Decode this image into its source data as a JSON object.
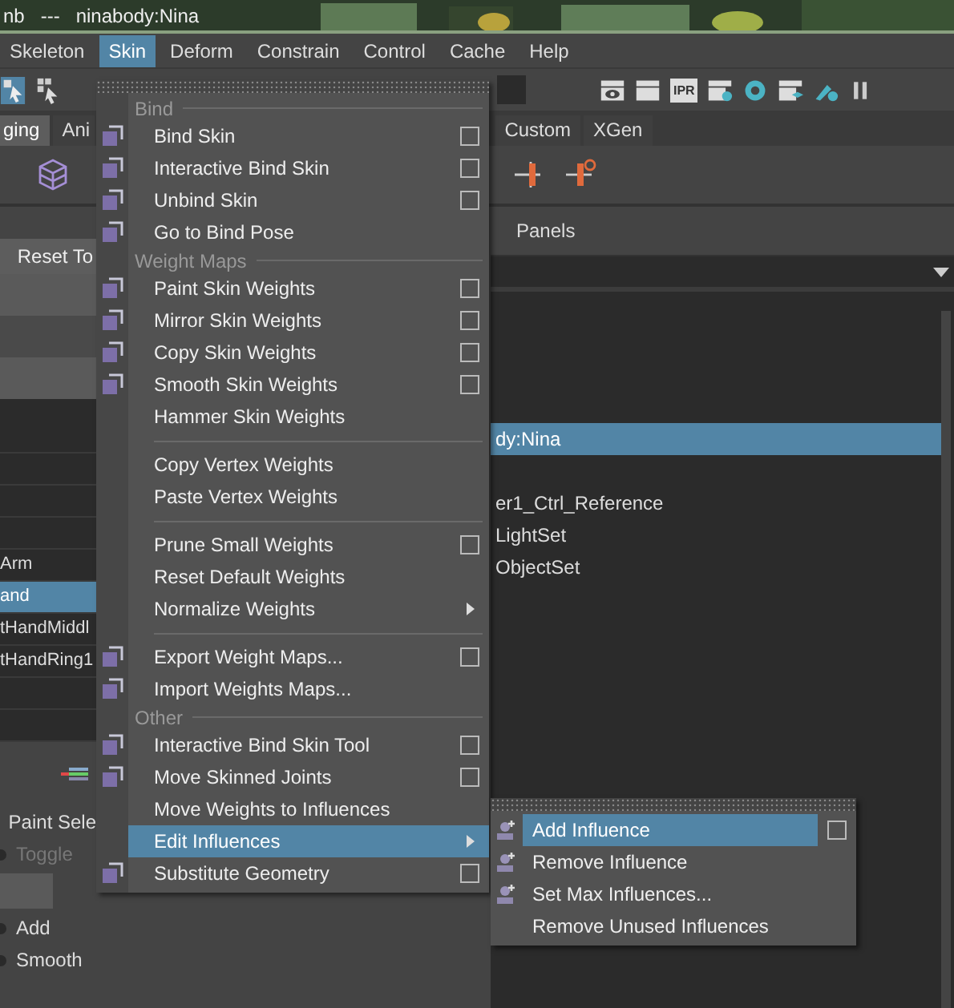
{
  "title_bar": {
    "text": "nb   ---   ninabody:Nina"
  },
  "menu_bar": [
    {
      "label": "Skeleton",
      "selected": false
    },
    {
      "label": "Skin",
      "selected": true
    },
    {
      "label": "Deform",
      "selected": false
    },
    {
      "label": "Constrain",
      "selected": false
    },
    {
      "label": "Control",
      "selected": false
    },
    {
      "label": "Cache",
      "selected": false
    },
    {
      "label": "Help",
      "selected": false
    }
  ],
  "toolbar": {
    "render_label": "IPR"
  },
  "shelf_tabs": [
    {
      "label": "ging",
      "selected": true
    },
    {
      "label": "Ani",
      "selected": false
    },
    {
      "label": "Custom",
      "selected": false
    },
    {
      "label": "XGen",
      "selected": false
    }
  ],
  "left_panel": {
    "reset_button": "Reset To",
    "rows": [
      {
        "label": "Arm",
        "selected": false
      },
      {
        "label": "and",
        "selected": true
      },
      {
        "label": "tHandMiddl",
        "selected": false
      },
      {
        "label": "tHandRing1",
        "selected": false
      }
    ],
    "options": [
      {
        "label": "Paint Sele",
        "disabled": false
      },
      {
        "label": "Toggle",
        "disabled": true
      },
      {
        "kind": "field"
      },
      {
        "label": "Add",
        "disabled": false
      },
      {
        "label": "Smooth",
        "disabled": false
      }
    ]
  },
  "outliner": {
    "header": "Panels",
    "rows": [
      {
        "label": "dy:Nina",
        "selected": true
      },
      {
        "label": "er1_Ctrl_Reference",
        "selected": false
      },
      {
        "label": "LightSet",
        "selected": false
      },
      {
        "label": "ObjectSet",
        "selected": false
      }
    ]
  },
  "skin_menu": [
    {
      "kind": "header",
      "label": "Bind"
    },
    {
      "kind": "item",
      "label": "Bind Skin",
      "icon": true,
      "option_box": true,
      "submenu": false,
      "highlighted": false
    },
    {
      "kind": "item",
      "label": "Interactive Bind Skin",
      "icon": true,
      "option_box": true,
      "submenu": false,
      "highlighted": false
    },
    {
      "kind": "item",
      "label": "Unbind Skin",
      "icon": true,
      "option_box": true,
      "submenu": false,
      "highlighted": false
    },
    {
      "kind": "item",
      "label": "Go to Bind Pose",
      "icon": true,
      "option_box": false,
      "submenu": false,
      "highlighted": false
    },
    {
      "kind": "header",
      "label": "Weight Maps"
    },
    {
      "kind": "item",
      "label": "Paint Skin Weights",
      "icon": true,
      "option_box": true,
      "submenu": false,
      "highlighted": false
    },
    {
      "kind": "item",
      "label": "Mirror Skin Weights",
      "icon": true,
      "option_box": true,
      "submenu": false,
      "highlighted": false
    },
    {
      "kind": "item",
      "label": "Copy Skin Weights",
      "icon": true,
      "option_box": true,
      "submenu": false,
      "highlighted": false
    },
    {
      "kind": "item",
      "label": "Smooth Skin Weights",
      "icon": true,
      "option_box": true,
      "submenu": false,
      "highlighted": false
    },
    {
      "kind": "item",
      "label": "Hammer Skin Weights",
      "icon": false,
      "option_box": false,
      "submenu": false,
      "highlighted": false
    },
    {
      "kind": "separator"
    },
    {
      "kind": "item",
      "label": "Copy Vertex Weights",
      "icon": false,
      "option_box": false,
      "submenu": false,
      "highlighted": false
    },
    {
      "kind": "item",
      "label": "Paste Vertex Weights",
      "icon": false,
      "option_box": false,
      "submenu": false,
      "highlighted": false
    },
    {
      "kind": "separator"
    },
    {
      "kind": "item",
      "label": "Prune Small Weights",
      "icon": false,
      "option_box": true,
      "submenu": false,
      "highlighted": false
    },
    {
      "kind": "item",
      "label": "Reset Default Weights",
      "icon": false,
      "option_box": false,
      "submenu": false,
      "highlighted": false
    },
    {
      "kind": "item",
      "label": "Normalize Weights",
      "icon": false,
      "option_box": false,
      "submenu": true,
      "highlighted": false
    },
    {
      "kind": "separator"
    },
    {
      "kind": "item",
      "label": "Export Weight Maps...",
      "icon": true,
      "option_box": true,
      "submenu": false,
      "highlighted": false
    },
    {
      "kind": "item",
      "label": "Import Weights Maps...",
      "icon": true,
      "option_box": false,
      "submenu": false,
      "highlighted": false
    },
    {
      "kind": "header",
      "label": "Other"
    },
    {
      "kind": "item",
      "label": "Interactive Bind Skin Tool",
      "icon": true,
      "option_box": true,
      "submenu": false,
      "highlighted": false
    },
    {
      "kind": "item",
      "label": "Move Skinned Joints",
      "icon": true,
      "option_box": true,
      "submenu": false,
      "highlighted": false
    },
    {
      "kind": "item",
      "label": "Move Weights to Influences",
      "icon": false,
      "option_box": false,
      "submenu": false,
      "highlighted": false
    },
    {
      "kind": "item",
      "label": "Edit Influences",
      "icon": false,
      "option_box": false,
      "submenu": true,
      "highlighted": true
    },
    {
      "kind": "item",
      "label": "Substitute Geometry",
      "icon": true,
      "option_box": true,
      "submenu": false,
      "highlighted": false
    }
  ],
  "influences_submenu": [
    {
      "label": "Add Influence",
      "icon": true,
      "option_box": true,
      "highlighted": true
    },
    {
      "label": "Remove Influence",
      "icon": true,
      "option_box": false,
      "highlighted": false
    },
    {
      "label": "Set Max Influences...",
      "icon": true,
      "option_box": false,
      "highlighted": false
    },
    {
      "label": "Remove Unused Influences",
      "icon": false,
      "option_box": false,
      "highlighted": false
    }
  ]
}
